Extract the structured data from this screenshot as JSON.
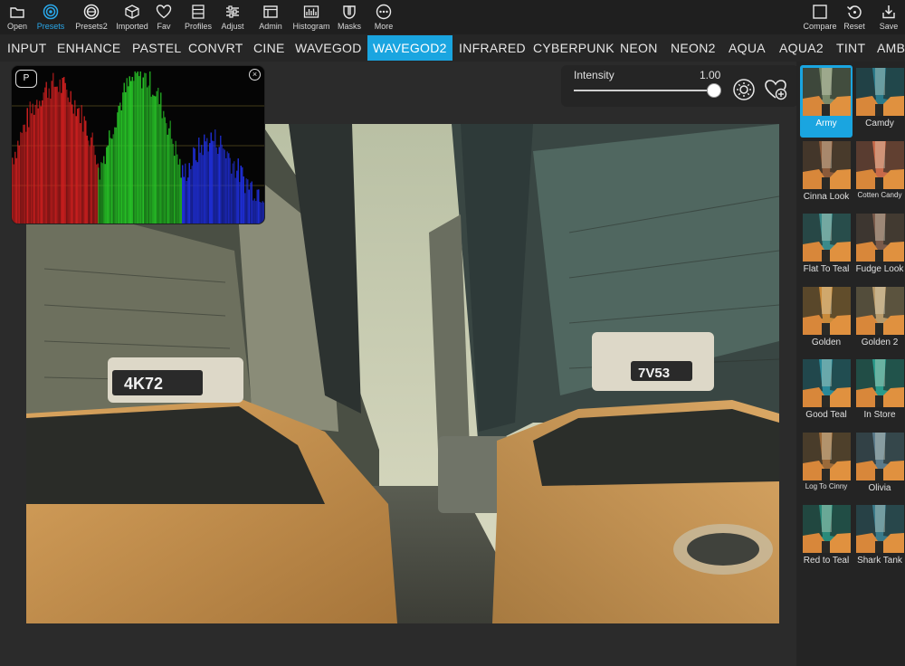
{
  "toolbar": {
    "left": [
      {
        "key": "open",
        "label": "Open",
        "icon": "folder-icon"
      },
      {
        "key": "presets",
        "label": "Presets",
        "icon": "presets-icon",
        "active": true
      },
      {
        "key": "presets2",
        "label": "Presets2",
        "icon": "presets2-icon"
      },
      {
        "key": "imported",
        "label": "Imported",
        "icon": "cube-icon"
      },
      {
        "key": "fav",
        "label": "Fav",
        "icon": "heart-icon"
      },
      {
        "key": "profiles",
        "label": "Profiles",
        "icon": "profiles-icon"
      },
      {
        "key": "adjust",
        "label": "Adjust",
        "icon": "sliders-icon"
      },
      {
        "key": "admin",
        "label": "Admin",
        "icon": "window-icon"
      },
      {
        "key": "histogram",
        "label": "Histogram",
        "icon": "histogram-icon"
      },
      {
        "key": "masks",
        "label": "Masks",
        "icon": "mask-icon"
      },
      {
        "key": "more",
        "label": "More",
        "icon": "more-icon"
      }
    ],
    "right": [
      {
        "key": "compare",
        "label": "Compare",
        "icon": "compare-icon"
      },
      {
        "key": "reset",
        "label": "Reset",
        "icon": "reset-icon"
      },
      {
        "key": "save",
        "label": "Save",
        "icon": "save-icon"
      }
    ]
  },
  "categories": [
    "INPUT",
    "ENHANCE",
    "PASTEL",
    "CONVRT",
    "CINE",
    "WAVEGOD",
    "WAVEGOD2",
    "INFRARED",
    "CYBERPUNK",
    "NEON",
    "NEON2",
    "AQUA",
    "AQUA2",
    "TINT",
    "AMB"
  ],
  "active_category": "WAVEGOD2",
  "histogram": {
    "p_label": "P",
    "close_glyph": "×"
  },
  "intensity": {
    "label": "Intensity",
    "value": "1.00",
    "level": 1.0
  },
  "presets": [
    {
      "name": "Army",
      "selected": true,
      "tint": "#7a8a6a"
    },
    {
      "name": "Camdy",
      "tint": "#2a7a8a"
    },
    {
      "name": "Cinna Look",
      "tint": "#8a5a3a"
    },
    {
      "name": "Cotten Candy",
      "tint": "#c86a4a",
      "small": true
    },
    {
      "name": "Flat To Teal",
      "tint": "#3a8a8a"
    },
    {
      "name": "Fudge Look",
      "tint": "#7a5a4a"
    },
    {
      "name": "Golden",
      "tint": "#c88a3a"
    },
    {
      "name": "Golden 2",
      "tint": "#b89a6a"
    },
    {
      "name": "Good Teal",
      "tint": "#2a8a9a"
    },
    {
      "name": "In Store",
      "tint": "#2a9a8a"
    },
    {
      "name": "Log To Cinny",
      "tint": "#9a6a3a",
      "small": true
    },
    {
      "name": "Olivia",
      "tint": "#5a7a8a"
    },
    {
      "name": "Red to Teal",
      "tint": "#2a8a7a"
    },
    {
      "name": "Shark Tank",
      "tint": "#3a7a8a"
    }
  ],
  "photo": {
    "taxi_left_sign": "4K72",
    "taxi_right_sign": "7V53"
  },
  "colors": {
    "accent": "#1aa5e0",
    "toolbar_bg": "#1f1f1f",
    "panel_bg": "#242424"
  }
}
